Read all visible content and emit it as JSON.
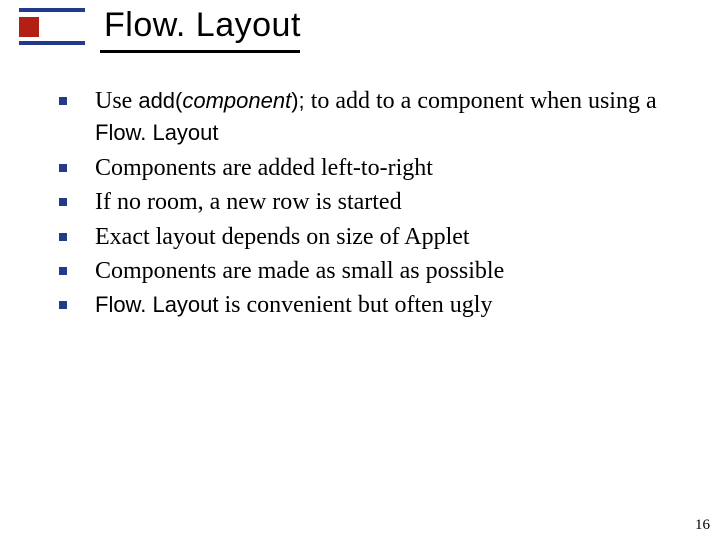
{
  "title": "Flow. Layout",
  "bullets": [
    {
      "pre": "Use   ",
      "code_a": "add(",
      "code_i": "component",
      "code_b": ");",
      "mid": "   to add to a component when using a ",
      "sans": "Flow. Layout"
    },
    {
      "text": "Components are added left-to-right"
    },
    {
      "text": "If no room, a new row is started"
    },
    {
      "text": "Exact layout depends on size of Applet"
    },
    {
      "text": "Components are made as small as possible"
    },
    {
      "sans_lead": "Flow. Layout",
      "tail": " is convenient but often ugly"
    }
  ],
  "page_number": "16"
}
